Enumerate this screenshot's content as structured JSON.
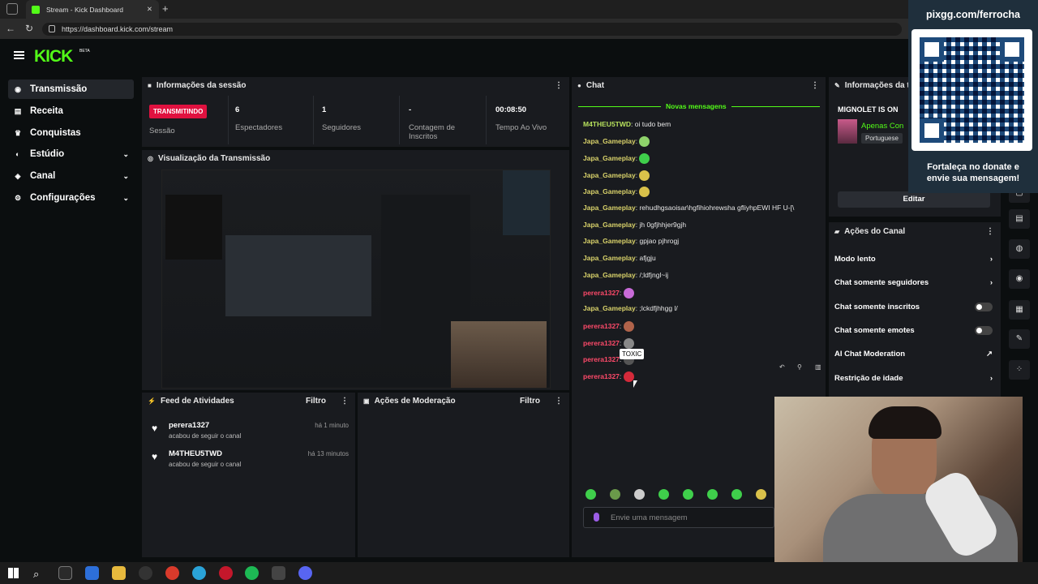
{
  "browser": {
    "tab_title": "Stream - Kick Dashboard",
    "url": "https://dashboard.kick.com/stream"
  },
  "header": {
    "logo": "KICK",
    "beta": "BETA"
  },
  "sidebar": {
    "items": [
      {
        "label": "Transmissão",
        "icon": "broadcast-icon",
        "active": true
      },
      {
        "label": "Receita",
        "icon": "revenue-icon"
      },
      {
        "label": "Conquistas",
        "icon": "trophy-icon"
      },
      {
        "label": "Estúdio",
        "icon": "studio-icon",
        "expandable": true
      },
      {
        "label": "Canal",
        "icon": "channel-icon",
        "expandable": true
      },
      {
        "label": "Configurações",
        "icon": "gear-icon",
        "expandable": true
      }
    ]
  },
  "session": {
    "title": "Informações da sessão",
    "badge": "TRANSMITINDO",
    "badge_label": "Sessão",
    "stats": [
      {
        "value": "6",
        "label": "Espectadores"
      },
      {
        "value": "1",
        "label": "Seguidores"
      },
      {
        "value": "-",
        "label": "Contagem de Inscritos"
      },
      {
        "value": "00:08:50",
        "label": "Tempo Ao Vivo"
      }
    ]
  },
  "preview": {
    "title": "Visualização da Transmissão"
  },
  "feed": {
    "title": "Feed de Atividades",
    "filter": "Filtro",
    "items": [
      {
        "user": "perera1327",
        "action": "acabou de seguir o canal",
        "time": "há 1 minuto"
      },
      {
        "user": "M4THEU5TWD",
        "action": "acabou de seguir o canal",
        "time": "há 13 minutos"
      }
    ]
  },
  "moderation": {
    "title": "Ações de Moderação",
    "filter": "Filtro"
  },
  "chat": {
    "title": "Chat",
    "new_messages": "Novas mensagens",
    "placeholder": "Envie uma mensagem",
    "tooltip": "TOXIC",
    "messages": [
      {
        "user": "M4THEU5TWD",
        "text": "oi tudo bem",
        "color": "green"
      },
      {
        "user": "Japa_Gameplay",
        "text": "",
        "emote": "#8fd36b"
      },
      {
        "user": "Japa_Gameplay",
        "text": "",
        "emote": "#3fcf4b"
      },
      {
        "user": "Japa_Gameplay",
        "text": "",
        "emote": "#d9c14a"
      },
      {
        "user": "Japa_Gameplay",
        "text": "",
        "emote": "#d9c14a"
      },
      {
        "user": "Japa_Gameplay",
        "text": "rehudhgsaoisar\\hgfihiohrewsha gfliyhpEWI HF U-[\\"
      },
      {
        "user": "Japa_Gameplay",
        "text": "jh 0gfjhhjer9gjh"
      },
      {
        "user": "Japa_Gameplay",
        "text": "gpjao pjhrogj"
      },
      {
        "user": "Japa_Gameplay",
        "text": "afjgju"
      },
      {
        "user": "Japa_Gameplay",
        "text": "/;ldfjngl~ij"
      },
      {
        "user": "perera1327",
        "text": "",
        "emote": "#c86bd8",
        "color": "red"
      },
      {
        "user": "Japa_Gameplay",
        "text": ";lckdfjhhgg l/"
      },
      {
        "user": "perera1327",
        "text": "",
        "emote": "#b0634a",
        "color": "red"
      },
      {
        "user": "perera1327",
        "text": "",
        "emote": "#888",
        "color": "red"
      },
      {
        "user": "perera1327",
        "text": "",
        "emote": "#555",
        "color": "red"
      },
      {
        "user": "perera1327",
        "text": "",
        "emote": "#d42a3a",
        "color": "red"
      }
    ]
  },
  "channel_info": {
    "title": "Informações da t",
    "streamer": "MIGNOLET IS ON",
    "category": "Apenas Con",
    "language": "Portuguese",
    "edit": "Editar"
  },
  "channel_actions": {
    "title": "Ações do Canal",
    "items": [
      {
        "label": "Modo lento",
        "control": "arrow"
      },
      {
        "label": "Chat somente seguidores",
        "control": "arrow"
      },
      {
        "label": "Chat somente inscritos",
        "control": "toggle"
      },
      {
        "label": "Chat somente emotes",
        "control": "toggle"
      },
      {
        "label": "AI Chat Moderation",
        "control": "external"
      },
      {
        "label": "Restrição de idade",
        "control": "arrow"
      }
    ]
  },
  "overlay": {
    "url": "pixgg.com/ferrocha",
    "text": "Fortaleça no donate e envie sua mensagem!"
  },
  "colors": {
    "accent": "#53fc18",
    "live_badge": "#e0113f",
    "panel": "#191b1f",
    "bg": "#0b0e0f"
  }
}
